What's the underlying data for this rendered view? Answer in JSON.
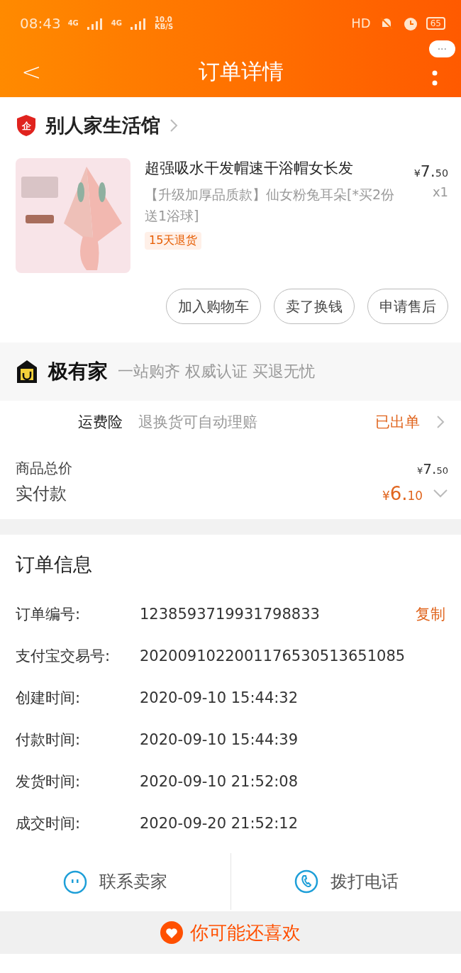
{
  "status_bar": {
    "time": "08:43",
    "signal_1": "4G",
    "signal_2": "4G",
    "speed": "10.0",
    "speed_unit": "KB/S",
    "hd": "HD",
    "battery": "65"
  },
  "header": {
    "back": "<",
    "title": "订单详情",
    "more": "···"
  },
  "shop": {
    "name": "别人家生活馆",
    "badge": "企"
  },
  "product": {
    "title": "超强吸水干发帽速干浴帽女长发",
    "sku": "【升级加厚品质款】仙女粉兔耳朵[*买2份送1浴球]",
    "tag": "15天退货",
    "price_symbol": "¥",
    "price_int": "7.",
    "price_dec": "50",
    "qty": "x1"
  },
  "actions": [
    "加入购物车",
    "卖了换钱",
    "申请售后"
  ],
  "brand": {
    "name": "极有家",
    "slogan": "一站购齐 权威认证 买退无忧"
  },
  "insurance": {
    "label": "运费险",
    "desc": "退换货可自动理赔",
    "status": "已出单"
  },
  "totals": {
    "goods_label": "商品总价",
    "goods_symbol": "¥",
    "goods_int": "7.",
    "goods_dec": "50",
    "paid_label": "实付款",
    "paid_symbol": "¥",
    "paid_int": "6.",
    "paid_dec": "10",
    "expanded": false
  },
  "order_info": {
    "title": "订单信息",
    "rows": [
      {
        "label": "订单编号:",
        "value": "1238593719931798833",
        "action": "复制"
      },
      {
        "label": "支付宝交易号:",
        "value": "2020091022001176530513651085"
      },
      {
        "label": "创建时间:",
        "value": "2020-09-10 15:44:32"
      },
      {
        "label": "付款时间:",
        "value": "2020-09-10 15:44:39"
      },
      {
        "label": "发货时间:",
        "value": "2020-09-10 21:52:08"
      },
      {
        "label": "成交时间:",
        "value": "2020-09-20 21:52:12"
      }
    ]
  },
  "contact": [
    {
      "kind": "chat",
      "label": "联系卖家"
    },
    {
      "kind": "phone",
      "label": "拨打电话"
    }
  ],
  "recommend": {
    "title": "你可能还喜欢"
  }
}
